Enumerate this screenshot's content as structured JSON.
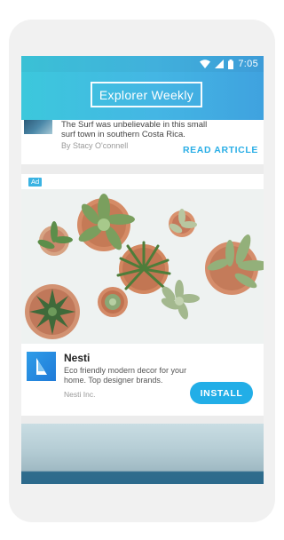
{
  "status_bar": {
    "time": "7:05"
  },
  "app_bar": {
    "title": "Explorer Weekly"
  },
  "article": {
    "text": "The Surf was unbelievable in this small surf town in southern Costa Rica.",
    "author": "By Stacy O'connell",
    "action_label": "READ ARTICLE"
  },
  "ad": {
    "badge": "Ad",
    "title": "Nesti",
    "description": "Eco friendly modern decor for your home. Top designer brands.",
    "company": "Nesti Inc.",
    "cta_label": "INSTALL"
  },
  "colors": {
    "accent": "#22aee7",
    "app_bar_start": "#3cc8dc",
    "app_bar_end": "#3fa2df"
  }
}
